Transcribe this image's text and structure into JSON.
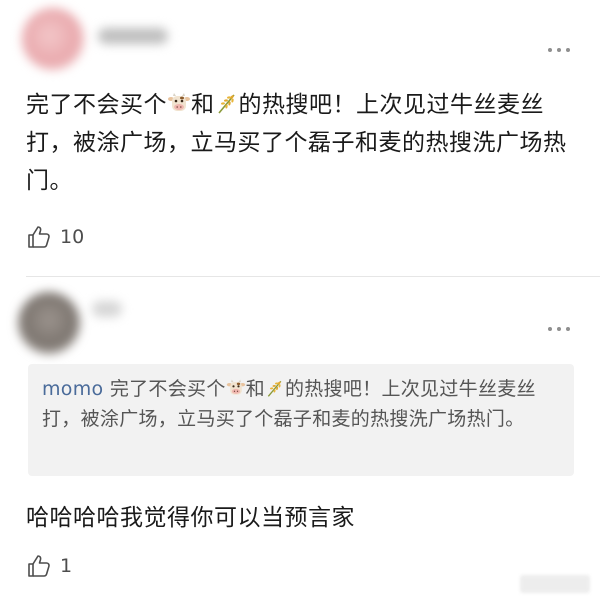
{
  "comments": [
    {
      "text_parts": [
        "完了不会买个",
        "和",
        "的热搜吧！上次见过牛丝麦丝打，被涂广场，立马买了个磊子和麦的热搜洗广场热门。"
      ],
      "likes": "10"
    },
    {
      "quote_author": "momo",
      "quote_parts": [
        "完了不会买个",
        "和",
        "的热搜吧！上次见过牛丝麦丝打，被涂广场，立马买了个磊子和麦的热搜洗广场热门。"
      ],
      "text": "哈哈哈哈我觉得你可以当预言家",
      "likes": "1"
    }
  ],
  "icons": {
    "more": "more-options-icon",
    "like": "thumbs-up-icon",
    "cow": "cow-face-emoji",
    "wheat": "wheat-emoji"
  },
  "colors": {
    "background": "#ffffff",
    "text": "#1a1a1a",
    "quote_background": "#f2f2f2",
    "quote_author": "#4a6b9a",
    "divider": "#e6e6e6"
  }
}
